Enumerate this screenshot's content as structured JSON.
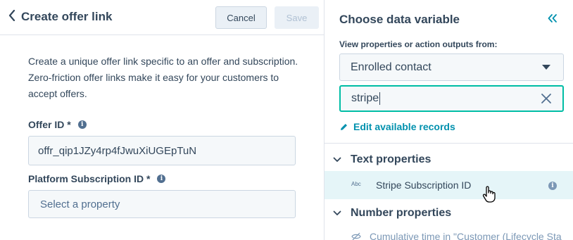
{
  "left": {
    "title": "Create offer link",
    "cancel_label": "Cancel",
    "save_label": "Save",
    "description": "Create a unique offer link specific to an offer and subscription. Zero-friction offer links make it easy for your customers to accept offers.",
    "offer_id": {
      "label": "Offer ID *",
      "value": "offr_qip1JZy4rp4fJwuXiUGEpTuN"
    },
    "subscription_id": {
      "label": "Platform Subscription ID *",
      "placeholder": "Select a property"
    }
  },
  "right": {
    "title": "Choose data variable",
    "view_label": "View properties or action outputs from:",
    "source_selected": "Enrolled contact",
    "search_value": "stripe",
    "edit_link": "Edit available records",
    "groups": [
      {
        "label": "Text properties",
        "items": [
          {
            "type_badge": "Abc",
            "label": "Stripe Subscription ID"
          }
        ]
      },
      {
        "label": "Number properties",
        "items": [
          {
            "label": "Cumulative time in \"Customer (Lifecycle Sta"
          }
        ]
      }
    ]
  },
  "colors": {
    "accent": "#0091ae",
    "focus_border": "#00bda5",
    "text": "#33475b",
    "highlight_row": "#e5f5f8"
  }
}
